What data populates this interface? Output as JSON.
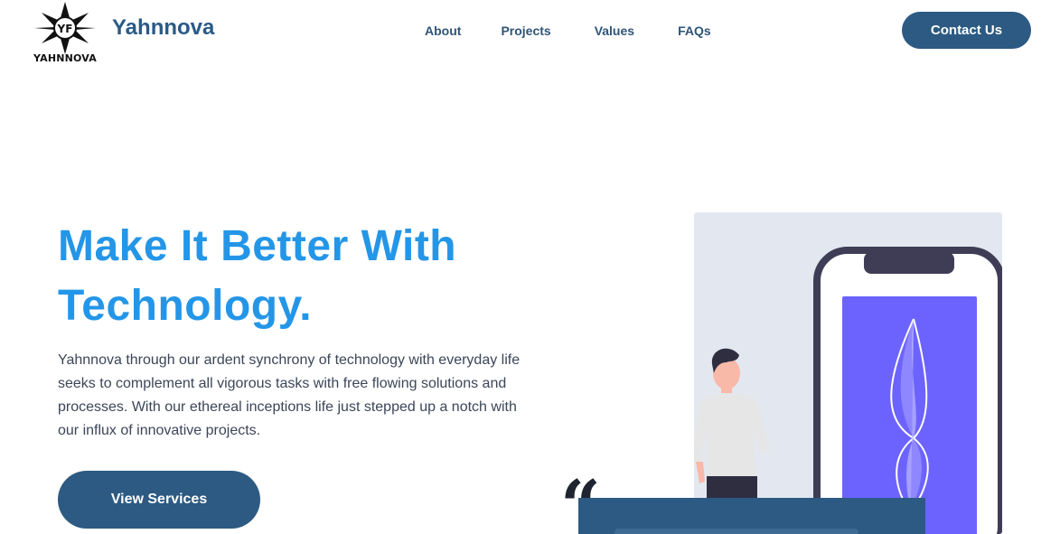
{
  "brand": {
    "name": "Yahnnova",
    "logo_wordmark": "YAHNNOVA",
    "logo_icon": "star-compass-logo"
  },
  "nav": {
    "items": [
      {
        "label": "About"
      },
      {
        "label": "Projects"
      },
      {
        "label": "Values"
      },
      {
        "label": "FAQs"
      }
    ],
    "contact_label": "Contact Us"
  },
  "hero": {
    "title_line1": "Make It Better With",
    "title_line2": "Technology.",
    "body": "Yahnnova through our ardent synchrony of technology with everyday life seeks to complement all vigorous tasks with free flowing solutions and processes. With our ethereal inceptions life just stepped up a notch with our influx of innovative projects.",
    "cta_label": "View Services"
  },
  "testimonial": {
    "quote_glyph": "“"
  },
  "colors": {
    "accent": "#2496e8",
    "primary": "#2c5a82",
    "illustration_bg": "#e3e8f0",
    "phone_screen": "#6c63ff"
  }
}
